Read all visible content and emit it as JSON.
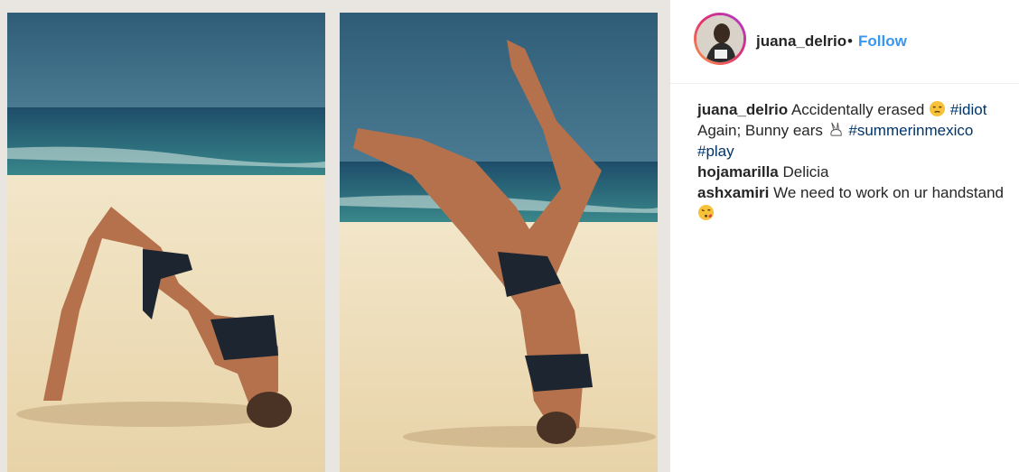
{
  "post": {
    "username": "juana_delrio",
    "separator": "•",
    "follow_label": "Follow"
  },
  "caption": {
    "username": "juana_delrio",
    "text1": "Accidentally erased",
    "hashtag1": "#idiot",
    "text2": "Again; Bunny ears",
    "hashtag2": "#summerinmexico",
    "hashtag3": "#play"
  },
  "comments": [
    {
      "username": "hojamarilla",
      "text": "Delicia"
    },
    {
      "username": "ashxamiri",
      "text": "We need to work on ur handstand"
    }
  ],
  "icons": {
    "emoji1": "unamused-face-emoji",
    "emoji2": "rabbit-emoji",
    "emoji3": "face-blowing-kiss-emoji"
  },
  "colors": {
    "follow": "#3897f0",
    "hashtag": "#003569",
    "text": "#262626"
  }
}
